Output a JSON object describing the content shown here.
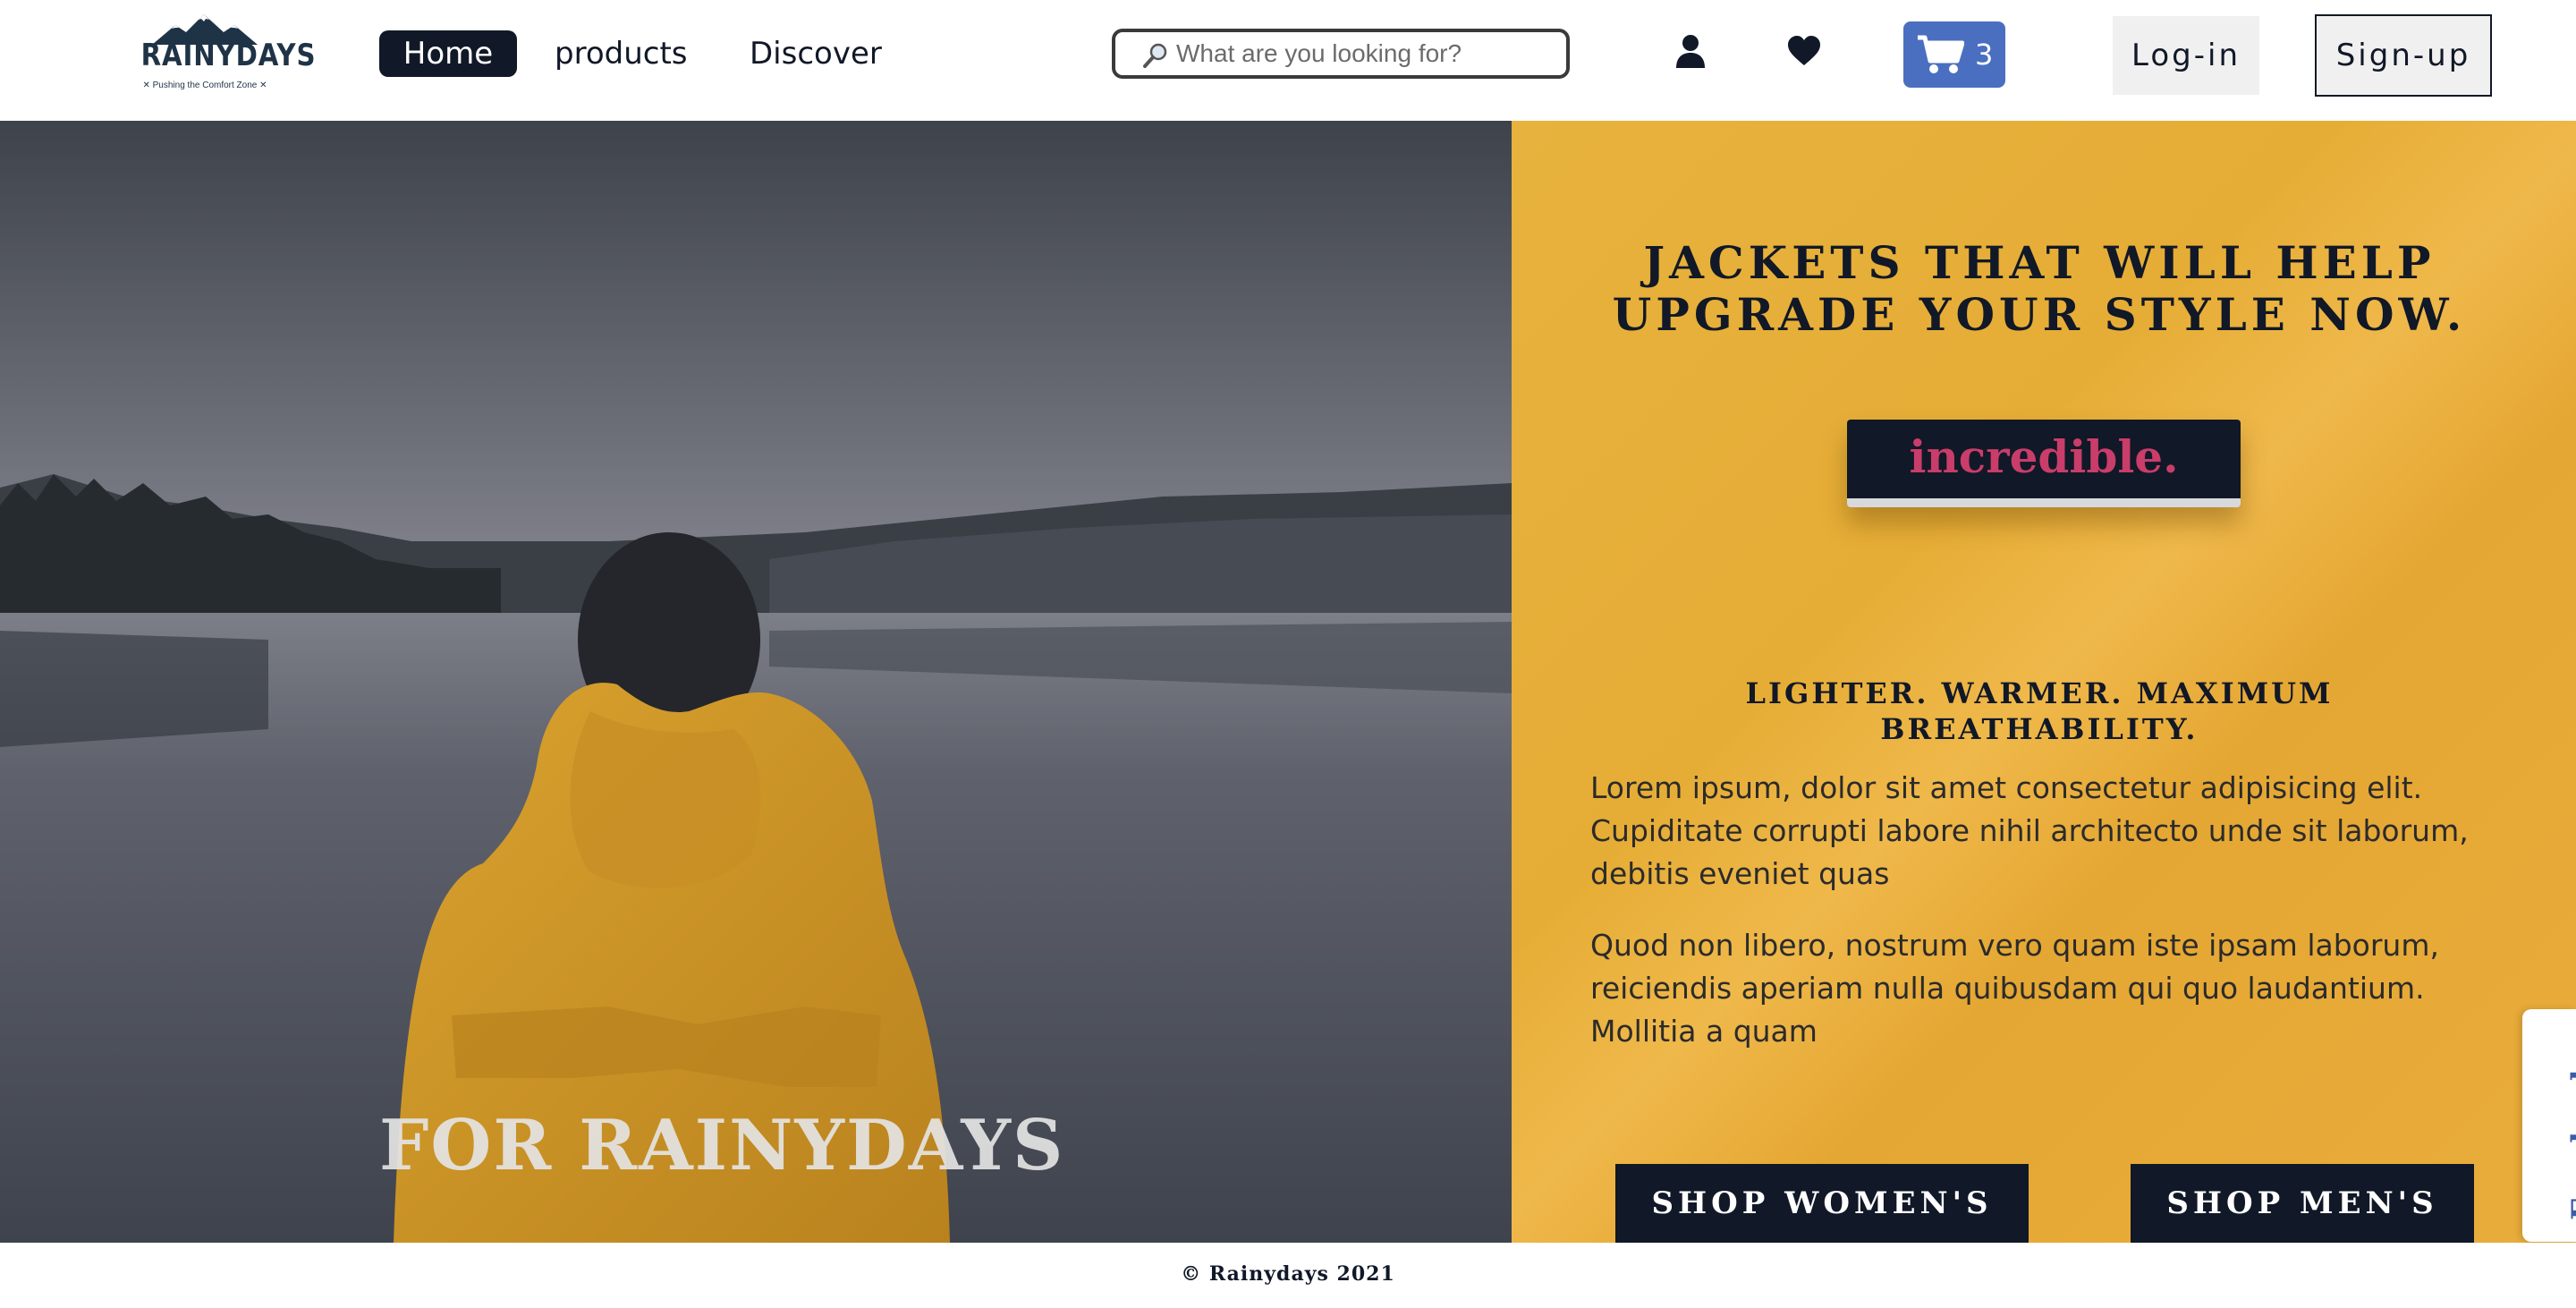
{
  "brand": {
    "name": "RAINYDAYS",
    "tagline": "✕ Pushing the Comfort Zone ✕"
  },
  "nav": {
    "items": [
      {
        "label": "Home",
        "active": true
      },
      {
        "label": "products",
        "active": false
      },
      {
        "label": "Discover",
        "active": false
      }
    ]
  },
  "search": {
    "placeholder": "What are you looking for?",
    "value": ""
  },
  "header_icons": {
    "user": "user-icon",
    "wishlist": "heart-icon",
    "cart": "cart-icon"
  },
  "cart": {
    "count": "3",
    "color": "#4a6fc0"
  },
  "auth": {
    "login_label": "Log-in",
    "signup_label": "Sign-up"
  },
  "hero": {
    "caption": "FOR RAINYDAYS"
  },
  "content": {
    "headline": "JACKETS THAT WILL HELP UPGRADE YOUR STYLE NOW.",
    "badge": "incredible.",
    "subheadline": "LIGHTER. WARMER. MAXIMUM BREATHABILITY.",
    "paragraph1": "Lorem ipsum, dolor sit amet consectetur adipisicing elit. Cupiditate corrupti labore nihil architecto unde sit laborum, debitis eveniet quas",
    "paragraph2": "Quod non libero, nostrum vero quam iste ipsam laborum, reiciendis aperiam nulla quibusdam qui quo laudantium. Mollitia a quam",
    "shop_women_label": "SHOP WOMEN'S",
    "shop_men_label": "SHOP MEN'S"
  },
  "social": {
    "facebook_label": "Facebook"
  },
  "footer": {
    "copyright": "© Rainydays 2021"
  },
  "colors": {
    "dark": "#111827",
    "accent_yellow": "#e6ad36",
    "badge_text": "#c93d6a",
    "facebook_blue": "#3b5ca6"
  }
}
